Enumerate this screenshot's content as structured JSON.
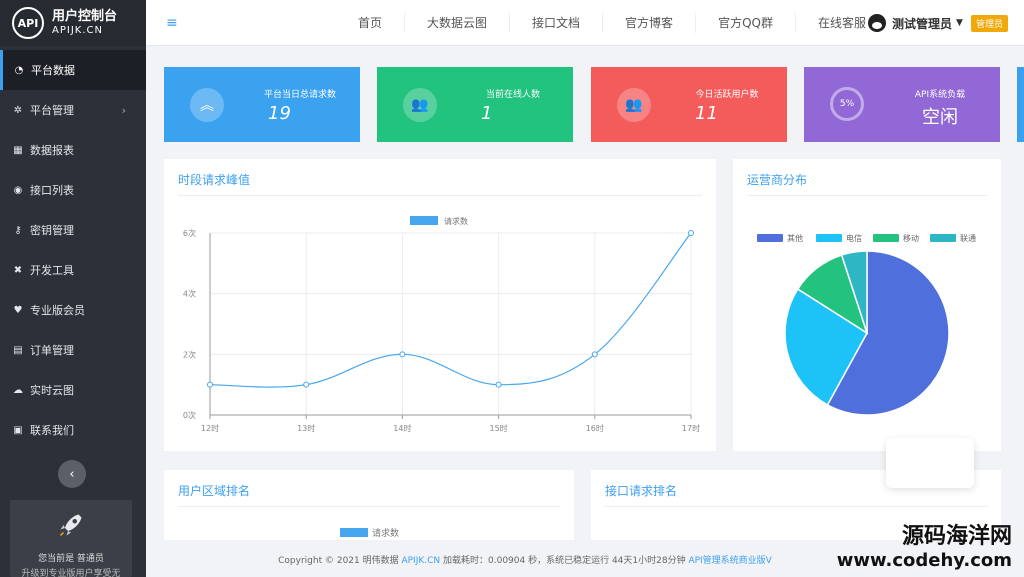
{
  "brand": {
    "logo_text": "API",
    "title": "用户控制台",
    "subtitle": "APIJK.CN"
  },
  "sidebar": {
    "items": [
      {
        "label": "平台数据",
        "icon": "dashboard-icon",
        "glyph": "◔"
      },
      {
        "label": "平台管理",
        "icon": "gear-icon",
        "glyph": "✲",
        "arrow": "›"
      },
      {
        "label": "数据报表",
        "icon": "area-chart-icon",
        "glyph": "▦"
      },
      {
        "label": "接口列表",
        "icon": "compass-icon",
        "glyph": "◉"
      },
      {
        "label": "密钥管理",
        "icon": "key-icon",
        "glyph": "⚷"
      },
      {
        "label": "开发工具",
        "icon": "tools-icon",
        "glyph": "✖"
      },
      {
        "label": "专业版会员",
        "icon": "vip-icon",
        "glyph": "♥"
      },
      {
        "label": "订单管理",
        "icon": "table-icon",
        "glyph": "▤"
      },
      {
        "label": "实时云图",
        "icon": "cloud-icon",
        "glyph": "☁"
      },
      {
        "label": "联系我们",
        "icon": "contact-card-icon",
        "glyph": "▣"
      }
    ],
    "collapse_glyph": "‹",
    "user_card": {
      "line1": "您当前是 普通员",
      "line2": "升级到专业版用户享受无"
    }
  },
  "topbar": {
    "menu_glyph": "≡",
    "nav": [
      "首页",
      "大数据云图",
      "接口文档",
      "官方博客",
      "官方QQ群",
      "在线客服"
    ],
    "user_name": "测试管理员",
    "caret": "▼",
    "badge": "管理员"
  },
  "stats": [
    {
      "label": "平台当日总请求数",
      "value": "19",
      "color": "#3ba2f0",
      "icon": "double-chevron-up-icon",
      "glyph": "︽"
    },
    {
      "label": "当前在线人数",
      "value": "1",
      "color": "#22c27f",
      "icon": "users-icon",
      "glyph": "👥"
    },
    {
      "label": "今日活跃用户数",
      "value": "11",
      "color": "#f45b5b",
      "icon": "user-group-icon",
      "glyph": "👥"
    },
    {
      "label": "API系统负载",
      "value": "空闲",
      "color": "#9168d6",
      "gauge": "5%"
    }
  ],
  "panels": {
    "peak": "时段请求峰值",
    "carrier": "运营商分布",
    "region": "用户区域排名",
    "api_rank": "接口请求排名",
    "region_legend": "请求数"
  },
  "chart_data": [
    {
      "type": "line",
      "x": [
        "12时",
        "13时",
        "14时",
        "15时",
        "16时",
        "17时"
      ],
      "series": [
        {
          "name": "请求数",
          "values": [
            1,
            1,
            2,
            1,
            2,
            6
          ]
        }
      ],
      "ylim": [
        0,
        6
      ],
      "yticks": [
        "0次",
        "2次",
        "4次",
        "6次"
      ],
      "grid": true,
      "legend": "top-center",
      "color": "#46a6ee"
    },
    {
      "type": "pie",
      "categories": [
        "其他",
        "电信",
        "移动",
        "联通"
      ],
      "values": [
        58,
        26,
        11,
        5
      ],
      "colors": [
        "#4f6fdc",
        "#1dc3f6",
        "#23c27f",
        "#2fb6c4"
      ],
      "legend": "top"
    }
  ],
  "footer": {
    "text": "Copyright © 2021 明伟数据 ",
    "link1": "APIJK.CN",
    "text2": " 加载耗时：0.00904 秒，系统已稳定运行 44天1小时28分钟 ",
    "link2": "API管理系统商业版V"
  },
  "watermark": {
    "line1": "源码海洋网",
    "line2": "www.codehy.com"
  }
}
